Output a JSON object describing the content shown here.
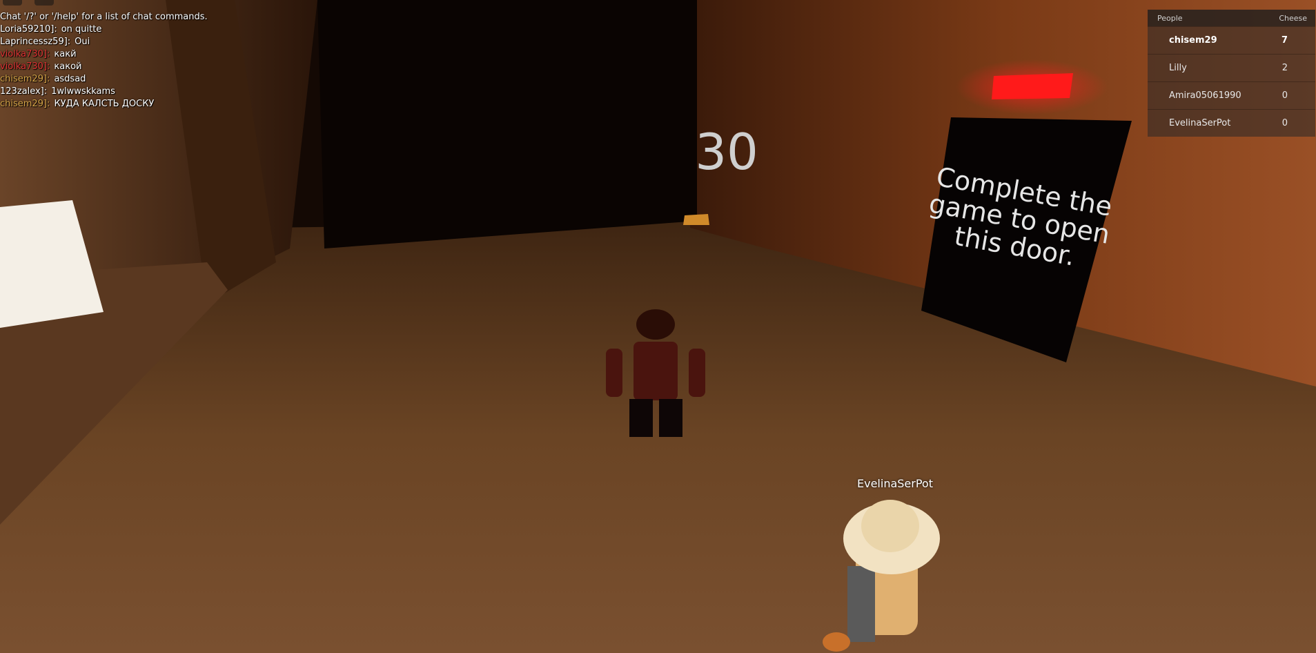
{
  "chat": {
    "system_message": "Chat '/?' or '/help' for a list of chat commands.",
    "messages": [
      {
        "user": "Loria59210]:",
        "text": "on quitte",
        "color": "#ffffff"
      },
      {
        "user": "Laprincessz59]:",
        "text": "Oui",
        "color": "#ffffff"
      },
      {
        "user": "violka730]:",
        "text": "какй",
        "color": "#e03434"
      },
      {
        "user": "violka730]:",
        "text": "какой",
        "color": "#e03434"
      },
      {
        "user": "chisem29]:",
        "text": "asdsad",
        "color": "#d7a548"
      },
      {
        "user": "123zalex]:",
        "text": "1wlwwskkams",
        "color": "#ffffff"
      },
      {
        "user": "chisem29]:",
        "text": "КУДА КАЛСТЬ ДОСКУ",
        "color": "#d7a548"
      }
    ]
  },
  "leaderboard": {
    "col_people": "People",
    "col_score": "Cheese",
    "rows": [
      {
        "name": "chisem29",
        "score": "7"
      },
      {
        "name": "Lilly",
        "score": "2"
      },
      {
        "name": "Amira05061990",
        "score": "0"
      },
      {
        "name": "EvelinaSerPot",
        "score": "0"
      }
    ]
  },
  "world": {
    "room_number": "30",
    "door_sign": [
      "Complete the",
      "game to open",
      "this door."
    ],
    "player_nametag": "EvelinaSerPot",
    "exit_light_color": "#ff1a1a"
  }
}
